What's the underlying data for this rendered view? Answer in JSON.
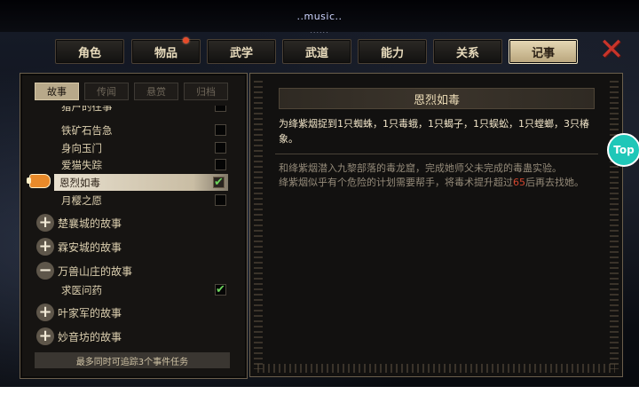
{
  "status": {
    "title": "..music..",
    "dots": "......"
  },
  "tabs": [
    {
      "label": "角色"
    },
    {
      "label": "物品",
      "badge": true
    },
    {
      "label": "武学"
    },
    {
      "label": "武道"
    },
    {
      "label": "能力"
    },
    {
      "label": "关系"
    },
    {
      "label": "记事",
      "active": true
    }
  ],
  "close": {
    "icon": "close-x-icon",
    "glyph": "✕"
  },
  "left": {
    "subtabs": [
      {
        "label": "故事",
        "active": true
      },
      {
        "label": "传闻"
      },
      {
        "label": "悬赏"
      },
      {
        "label": "归档"
      }
    ],
    "items": [
      {
        "label": "猎户的往事",
        "checked": false
      },
      {
        "label": "铁矿石告急",
        "checked": false
      },
      {
        "label": "身向玉门",
        "checked": false
      },
      {
        "label": "爱猫失踪",
        "checked": false
      },
      {
        "label": "恩烈如毒",
        "checked": true,
        "selected": true
      },
      {
        "label": "月樱之愿",
        "checked": false
      }
    ],
    "groups": [
      {
        "label": "楚襄城的故事",
        "sign": "+"
      },
      {
        "label": "霖安城的故事",
        "sign": "+"
      },
      {
        "label": "万兽山庄的故事",
        "sign": "−"
      }
    ],
    "sub_item": {
      "label": "求医问药",
      "checked": true
    },
    "groups2": [
      {
        "label": "叶家军的故事",
        "sign": "+"
      },
      {
        "label": "妙音坊的故事",
        "sign": "+"
      }
    ],
    "footer": "最多同时可追踪3个事件任务"
  },
  "right": {
    "title": "恩烈如毒",
    "objective": "为绛紫烟捉到1只蜘蛛，1只毒蛾，1只蝎子，1只蜈蚣，1只螳螂，3只椿象。",
    "desc_line1": "和绛紫烟潜入九黎部落的毒龙窟，完成她师父未完成的毒蛊实验。",
    "desc_line2_pre": "绛紫烟似乎有个危险的计划需要帮手，将毒术提升超过",
    "desc_line2_num": "65",
    "desc_line2_post": "后再去找她。"
  },
  "top_badge": "Top"
}
